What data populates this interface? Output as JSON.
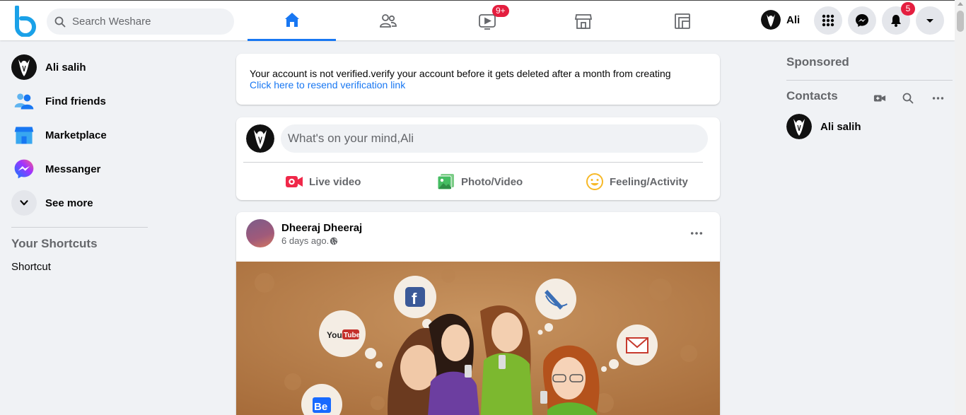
{
  "search": {
    "placeholder": "Search Weshare"
  },
  "nav": {
    "tabs": [
      {
        "name": "home",
        "icon": "home-icon",
        "active": true
      },
      {
        "name": "friends",
        "icon": "friends-icon",
        "active": false
      },
      {
        "name": "watch",
        "icon": "video-icon",
        "badge": "9+",
        "active": false
      },
      {
        "name": "marketplace",
        "icon": "store-icon",
        "active": false
      },
      {
        "name": "gaming",
        "icon": "gaming-icon",
        "active": false
      }
    ],
    "watch_badge": "9+"
  },
  "header": {
    "profile_name": "Ali",
    "notifications_count": "5"
  },
  "sidebar": {
    "items": [
      {
        "label": "Ali salih",
        "icon": "avatar"
      },
      {
        "label": "Find friends",
        "icon": "friends-icon"
      },
      {
        "label": "Marketplace",
        "icon": "store-icon"
      },
      {
        "label": "Messanger",
        "icon": "messenger-icon"
      },
      {
        "label": "See more",
        "icon": "chevron-down-icon"
      }
    ],
    "shortcuts_heading": "Your Shortcuts",
    "shortcut_label": "Shortcut"
  },
  "feed": {
    "verify": {
      "message": "Your account is not verified.verify your account before it gets deleted after a month from creating",
      "link": "Click here to resend verification link"
    },
    "composer": {
      "placeholder": "What's on your mind,Ali",
      "live_label": "Live video",
      "photo_label": "Photo/Video",
      "feeling_label": "Feeling/Activity"
    },
    "post": {
      "author": "Dheeraj Dheeraj",
      "time": "6 days ago."
    }
  },
  "right": {
    "sponsored": "Sponsored",
    "contacts_heading": "Contacts",
    "contacts": [
      {
        "name": "Ali salih"
      }
    ]
  },
  "colors": {
    "accent": "#1877f2",
    "badge": "#e41e3f",
    "background": "#f0f2f5"
  }
}
